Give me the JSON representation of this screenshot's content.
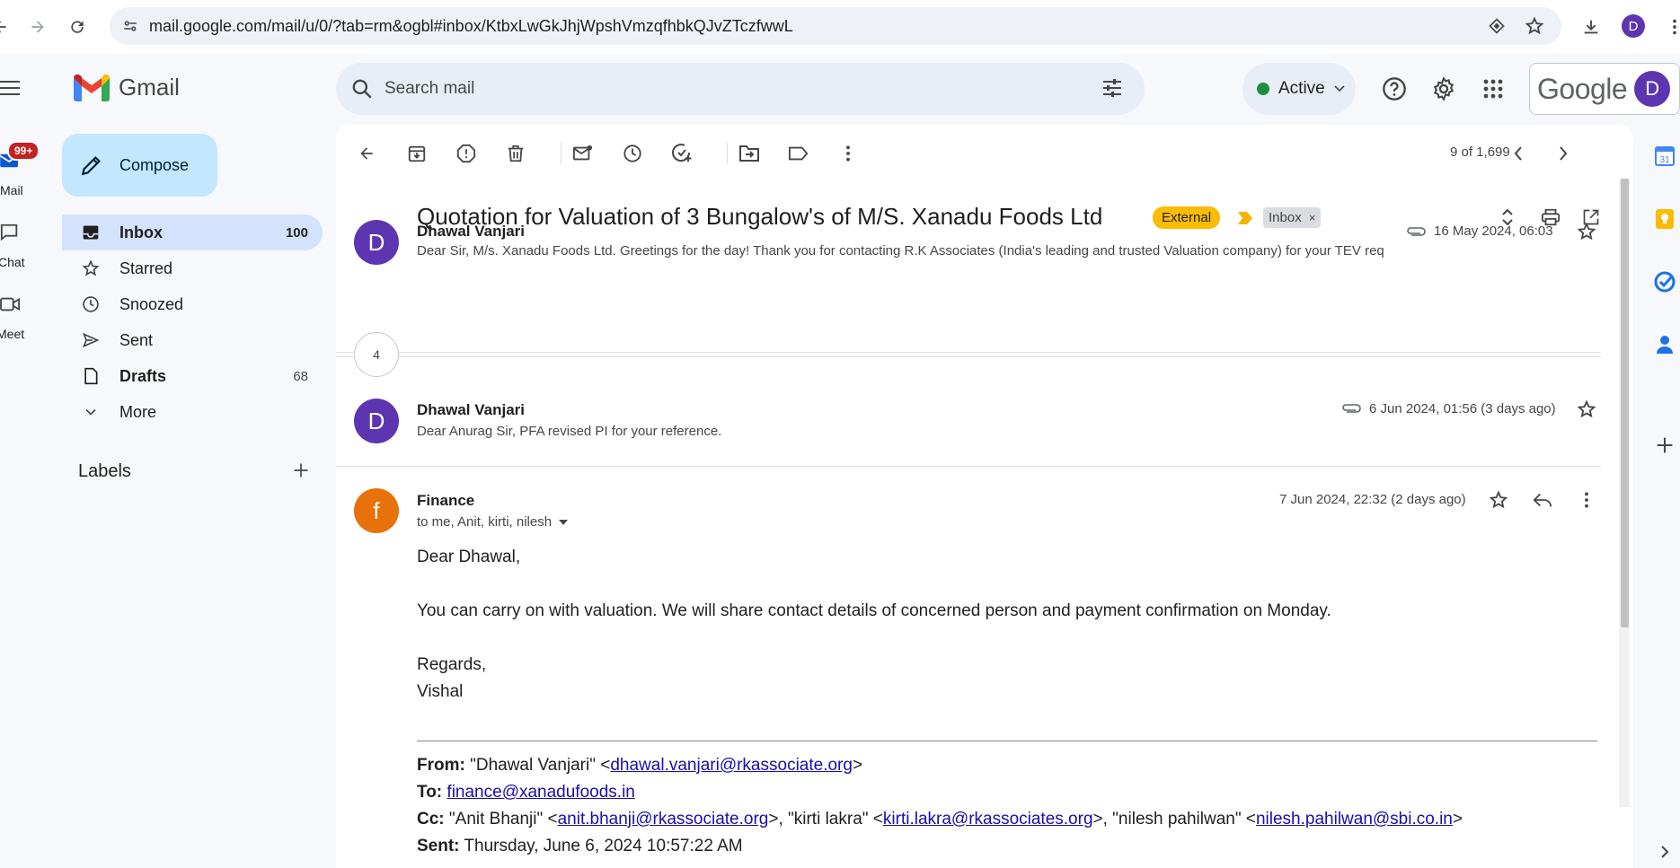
{
  "browser": {
    "url": "mail.google.com/mail/u/0/?tab=rm&ogbl#inbox/KtbxLwGkJhjWpshVmzqfhbkQJvZTczfwwL",
    "profile_initial": "D"
  },
  "rail": {
    "mail_label": "Mail",
    "mail_badge": "99+",
    "chat_label": "Chat",
    "meet_label": "Meet"
  },
  "header": {
    "app_name": "Gmail",
    "search_placeholder": "Search mail",
    "status": "Active",
    "google_word": "Google",
    "account_initial": "D"
  },
  "sidebar": {
    "compose_label": "Compose",
    "folders": [
      {
        "label": "Inbox",
        "count": "100"
      },
      {
        "label": "Starred",
        "count": ""
      },
      {
        "label": "Snoozed",
        "count": ""
      },
      {
        "label": "Sent",
        "count": ""
      },
      {
        "label": "Drafts",
        "count": "68"
      },
      {
        "label": "More",
        "count": ""
      }
    ],
    "labels_heading": "Labels"
  },
  "thread": {
    "pager": "9 of 1,699",
    "subject": "Quotation for Valuation of 3 Bungalow's of M/S. Xanadu Foods Ltd",
    "label_external": "External",
    "label_inbox": "Inbox",
    "collapsed_count": "4",
    "messages": [
      {
        "avatar": "D",
        "sender": "Dhawal Vanjari",
        "date": "16 May 2024, 06:03",
        "snippet": "Dear Sir, M/s. Xanadu Foods Ltd. Greetings for the day! Thank you for contacting R.K Associates (India's leading and trusted Valuation company) for your TEV req"
      },
      {
        "avatar": "D",
        "sender": "Dhawal Vanjari",
        "date": "6 Jun 2024, 01:56 (3 days ago)",
        "snippet": "Dear Anurag Sir, PFA revised PI for your reference."
      },
      {
        "avatar": "f",
        "sender": "Finance",
        "date": "7 Jun 2024, 22:32 (2 days ago)",
        "recipients": "to me, Anit, kirti, nilesh"
      }
    ],
    "body": {
      "greeting": "Dear Dhawal,",
      "line1": "You can carry on with valuation. We will share contact details of concerned person and payment confirmation on Monday.",
      "regards": "Regards,",
      "signature": "Vishal"
    },
    "quoted": {
      "from_label": "From:",
      "from_name": " \"Dhawal Vanjari\" <",
      "from_email": "dhawal.vanjari@rkassociate.org",
      "from_close": ">",
      "to_label": "To:",
      "to_email": "finance@xanadufoods.in",
      "cc_label": "Cc:",
      "cc1_name": " \"Anit Bhanji\" <",
      "cc1_email": "anit.bhanji@rkassociate.org",
      "cc2_name": ">, \"kirti lakra\" <",
      "cc2_email": "kirti.lakra@rkassociates.org",
      "cc3_name": ">, \"nilesh pahilwan\" <",
      "cc3_email": "nilesh.pahilwan@sbi.co.in",
      "cc_close": ">",
      "sent_label": "Sent:",
      "sent_value": " Thursday, June 6, 2024 10:57:22 AM"
    }
  },
  "colors": {
    "accent": "#0b57d0",
    "compose_bg": "#c2e7ff",
    "active_folder": "#d3e3fd",
    "avatar_d": "#5e35b1",
    "avatar_f": "#e8710a",
    "external_chip": "#fbbc04"
  }
}
